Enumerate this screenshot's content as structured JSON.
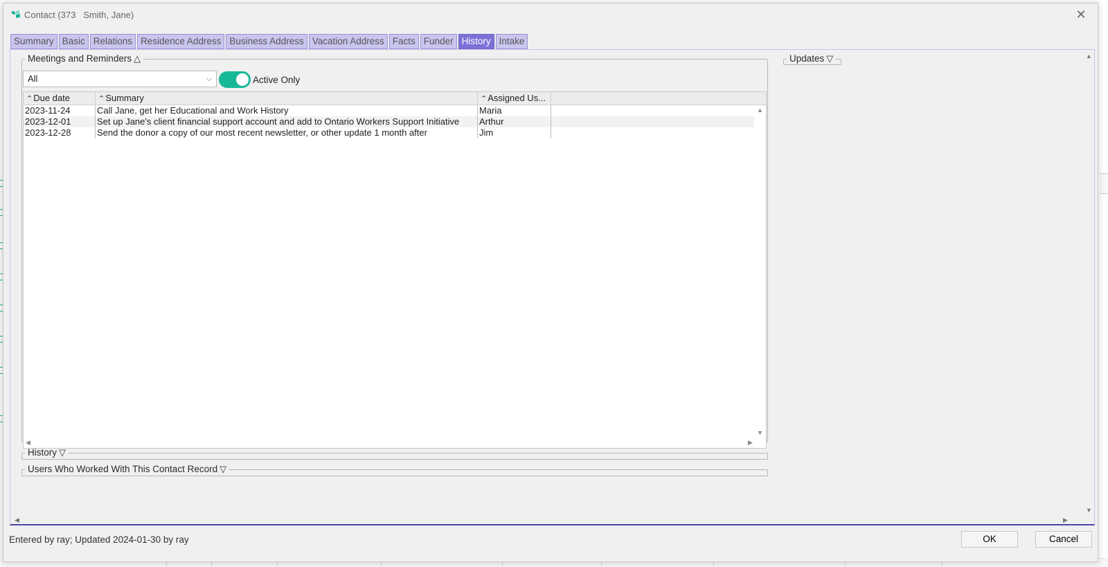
{
  "window": {
    "title": "Contact (373   Smith, Jane)",
    "app_icon": "flag-icon",
    "close_icon": "close-icon"
  },
  "tabs": [
    {
      "label": "Summary"
    },
    {
      "label": "Basic"
    },
    {
      "label": "Relations"
    },
    {
      "label": "Residence Address"
    },
    {
      "label": "Business Address"
    },
    {
      "label": "Vacation Address"
    },
    {
      "label": "Facts"
    },
    {
      "label": "Funder"
    },
    {
      "label": "History",
      "active": true
    },
    {
      "label": "Intake"
    }
  ],
  "meetings": {
    "title": "Meetings and Reminders",
    "collapse_glyph": "△",
    "filter_value": "All",
    "toggle_label": "Active Only",
    "toggle_on": true,
    "columns": [
      "Due date",
      "Summary",
      "Assigned Us..."
    ],
    "rows": [
      {
        "due": "2023-11-24",
        "summary": "Call Jane, get her Educational and Work History",
        "user": "Maria"
      },
      {
        "due": "2023-12-01",
        "summary": "Set up Jane's client financial support account and add to Ontario Workers Support Initiative",
        "user": "Arthur"
      },
      {
        "due": "2023-12-28",
        "summary": "Send the donor a copy of our most recent newsletter, or other update 1 month after",
        "user": "Jim"
      }
    ]
  },
  "history_section": {
    "title": "History",
    "expand_glyph": "▽"
  },
  "users_section": {
    "title": "Users Who Worked With This Contact Record",
    "expand_glyph": "▽"
  },
  "updates_section": {
    "title": "Updates",
    "expand_glyph": "▽"
  },
  "status_text": "Entered by ray; Updated 2024-01-30 by ray",
  "buttons": {
    "ok": "OK",
    "cancel": "Cancel"
  },
  "colors": {
    "accent": "#7b72d8",
    "tab_bg": "#c9c5ee",
    "toggle": "#17b898"
  }
}
